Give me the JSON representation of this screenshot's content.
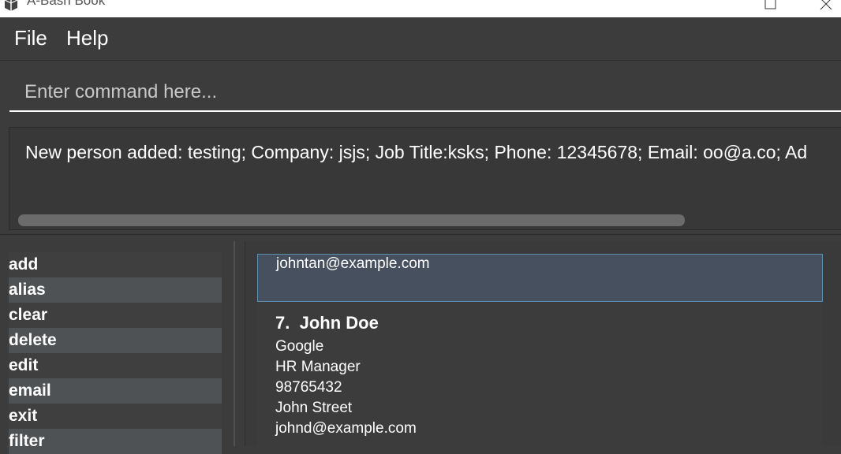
{
  "window": {
    "title": "A-Bash Book",
    "maximize_icon": "maximize-icon",
    "close_icon": "close-icon"
  },
  "menu": {
    "file": "File",
    "help": "Help"
  },
  "command_box": {
    "placeholder": "Enter command here...",
    "value": ""
  },
  "result": {
    "text": "New person added: testing; Company: jsjs; Job Title:ksks; Phone: 12345678; Email: oo@a.co; Ad"
  },
  "command_list": {
    "items": [
      "add",
      "alias",
      "clear",
      "delete",
      "edit",
      "email",
      "exit",
      "filter"
    ]
  },
  "person_list": {
    "selected_card": {
      "email": "johntan@example.com"
    },
    "card": {
      "index": "7.",
      "name": "John Doe",
      "company": "Google",
      "job_title": "HR Manager",
      "phone": "98765432",
      "address": "John Street",
      "email": "johnd@example.com"
    }
  },
  "colors": {
    "background": "#3c3c3c",
    "selected_card": "#46505e",
    "selected_border": "#5b8fb0",
    "list_alt_row": "#4f5254"
  }
}
